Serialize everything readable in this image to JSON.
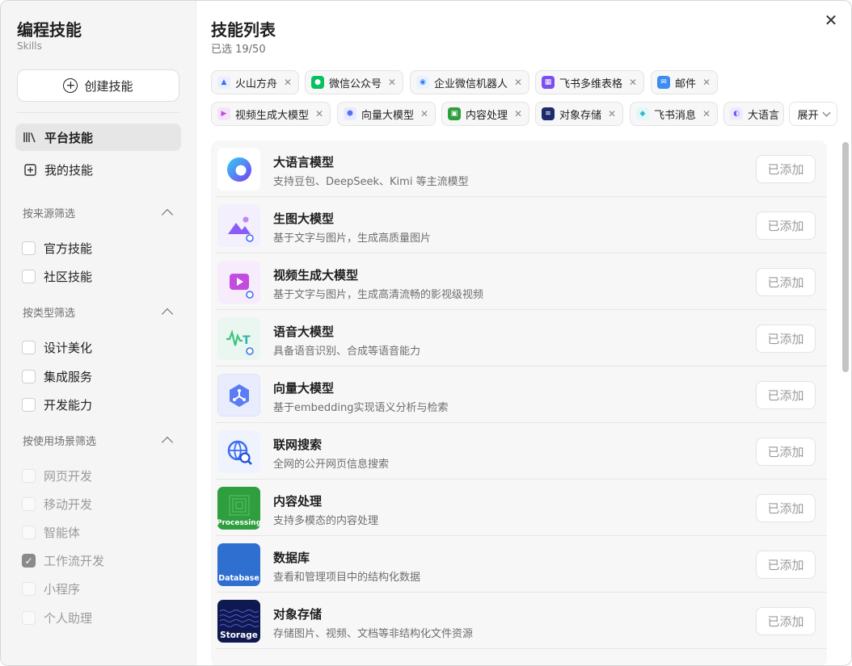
{
  "sidebar": {
    "title": "编程技能",
    "subtitle": "Skills",
    "create_label": "创建技能",
    "nav": [
      {
        "label": "平台技能",
        "active": true,
        "icon": "library-icon"
      },
      {
        "label": "我的技能",
        "active": false,
        "icon": "plus-square-icon"
      }
    ],
    "sections": [
      {
        "title": "按来源筛选",
        "items": [
          {
            "label": "官方技能",
            "checked": false
          },
          {
            "label": "社区技能",
            "checked": false
          }
        ]
      },
      {
        "title": "按类型筛选",
        "items": [
          {
            "label": "设计美化",
            "checked": false
          },
          {
            "label": "集成服务",
            "checked": false
          },
          {
            "label": "开发能力",
            "checked": false
          }
        ]
      },
      {
        "title": "按使用场景筛选",
        "items": [
          {
            "label": "网页开发",
            "checked": false
          },
          {
            "label": "移动开发",
            "checked": false
          },
          {
            "label": "智能体",
            "checked": false
          },
          {
            "label": "工作流开发",
            "checked": true
          },
          {
            "label": "小程序",
            "checked": false
          },
          {
            "label": "个人助理",
            "checked": false
          }
        ]
      }
    ]
  },
  "main": {
    "title": "技能列表",
    "selected_count": "已选 19/50",
    "expand_label": "展开",
    "chips_row1": [
      {
        "label": "火山方舟",
        "icon": "volcano-icon",
        "color": "#3b6cf6"
      },
      {
        "label": "微信公众号",
        "icon": "wechat-icon",
        "color": "#07c160"
      },
      {
        "label": "企业微信机器人",
        "icon": "wecom-bot-icon",
        "color": "#2f7df6"
      },
      {
        "label": "飞书多维表格",
        "icon": "bitable-icon",
        "color": "#7b4ff0"
      },
      {
        "label": "邮件",
        "icon": "mail-icon",
        "color": "#3d8cf0"
      }
    ],
    "chips_row2": [
      {
        "label": "视频生成大模型",
        "icon": "video-gen-icon",
        "color": "#c24be0"
      },
      {
        "label": "向量大模型",
        "icon": "vector-icon",
        "color": "#5b6cf0"
      },
      {
        "label": "内容处理",
        "icon": "processing-icon",
        "color": "#2e9e3e"
      },
      {
        "label": "对象存储",
        "icon": "storage-icon",
        "color": "#1d2a6b"
      },
      {
        "label": "飞书消息",
        "icon": "feishu-icon",
        "color": "#2db9c8"
      },
      {
        "label": "大语言",
        "icon": "llm-icon",
        "color": "#6a5cf6"
      }
    ],
    "skills": [
      {
        "name": "大语言模型",
        "desc": "支持豆包、DeepSeek、Kimi 等主流模型",
        "status": "已添加",
        "icon": "llm-icon"
      },
      {
        "name": "生图大模型",
        "desc": "基于文字与图片，生成高质量图片",
        "status": "已添加",
        "icon": "image-gen-icon"
      },
      {
        "name": "视频生成大模型",
        "desc": "基于文字与图片，生成高清流畅的影视级视频",
        "status": "已添加",
        "icon": "video-gen-icon"
      },
      {
        "name": "语音大模型",
        "desc": "具备语音识别、合成等语音能力",
        "status": "已添加",
        "icon": "speech-icon"
      },
      {
        "name": "向量大模型",
        "desc": "基于embedding实现语义分析与检索",
        "status": "已添加",
        "icon": "vector-icon"
      },
      {
        "name": "联网搜索",
        "desc": "全网的公开网页信息搜索",
        "status": "已添加",
        "icon": "web-search-icon"
      },
      {
        "name": "内容处理",
        "desc": "支持多模态的内容处理",
        "status": "已添加",
        "icon": "processing-icon",
        "icon_text": "Processing"
      },
      {
        "name": "数据库",
        "desc": "查看和管理项目中的结构化数据",
        "status": "已添加",
        "icon": "database-icon",
        "icon_text": "Database"
      },
      {
        "name": "对象存储",
        "desc": "存储图片、视频、文档等非结构化文件资源",
        "status": "已添加",
        "icon": "storage-icon",
        "icon_text": "Storage"
      }
    ]
  }
}
